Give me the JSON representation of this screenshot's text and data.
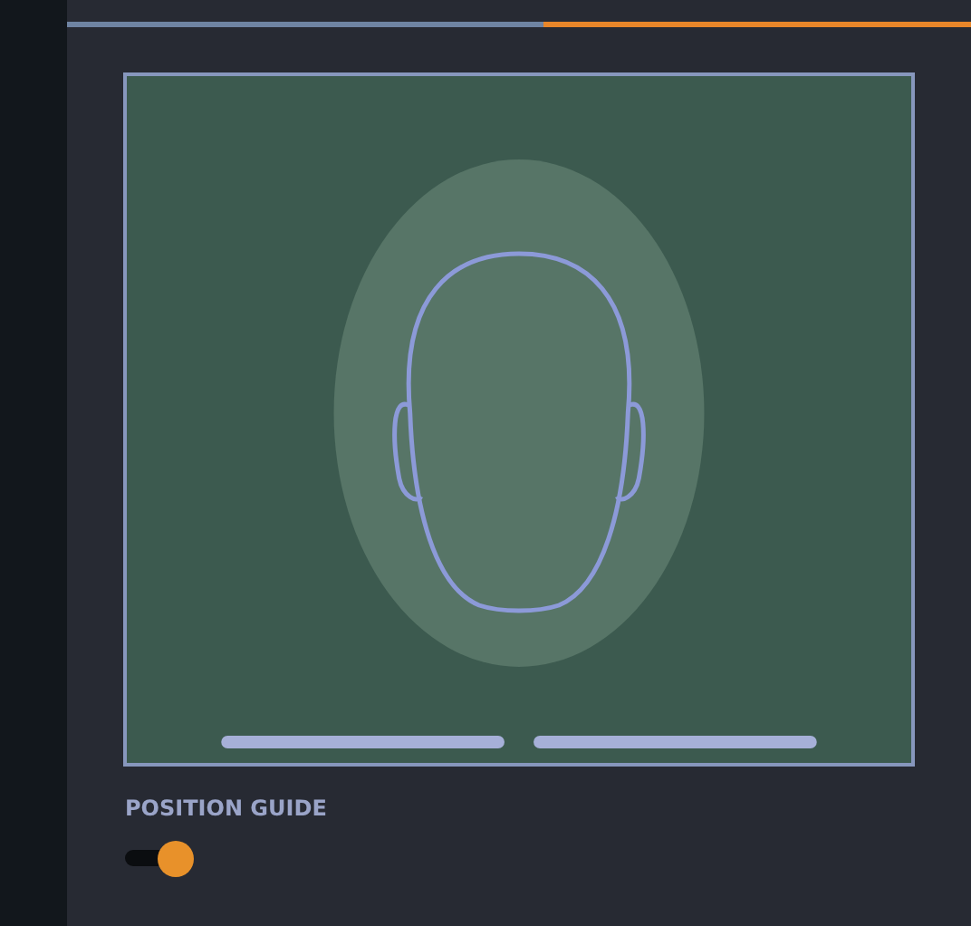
{
  "camera_view": {
    "kind": "guide"
  },
  "position_guide": {
    "label": "POSITION GUIDE",
    "on": true
  }
}
